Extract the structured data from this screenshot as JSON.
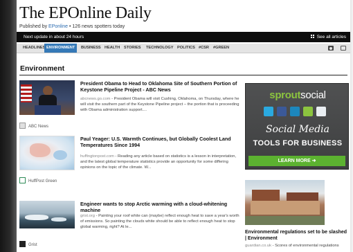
{
  "site": {
    "title": "The EPOnline Daily",
    "byline_prefix": "Published by",
    "byline_link": "EPonline",
    "byline_suffix": " • 126 news spotters today"
  },
  "topbar": {
    "next_update": "Next update in about 24 hours",
    "see_all": "See all articles"
  },
  "nav": {
    "items": [
      "HEADLINES",
      "ENVIRONMENT",
      "BUSINESS",
      "HEALTH",
      "STORIES",
      "TECHNOLOGY",
      "POLITICS",
      "#CSR",
      "#GREEN"
    ],
    "active": "ENVIRONMENT",
    "icons": [
      "camera-icon",
      "image-icon"
    ]
  },
  "section": {
    "title": "Environment"
  },
  "articles": [
    {
      "headline": "President Obama to Head to Oklahoma Site of Southern Portion of Keystone Pipeline Project - ABC News",
      "summary_source": "abcnews.go.com",
      "summary": " - President Obama will visit Cushing, Oklahoma, on Thursday, where he will visit the southern part of the Keystone Pipeline project – the portion that is proceeding with Obama administration support....",
      "source": "ABC News"
    },
    {
      "headline": "Paul Yeager: U.S. Warmth Continues, but Globally Coolest Land Temperatures Since 1994",
      "summary_source": "huffingtonpost.com",
      "summary": " - Reading any article based on statistics is a lesson in interpretation, and the latest global temperature statistics provide an opportunity for some differing opinions on the topic of the climate. W...",
      "source": "HuffPost Green"
    },
    {
      "headline": "Engineer wants to stop Arctic warming with a cloud-whitening machine",
      "summary_source": "grist.org",
      "summary": " - Painting your roof white can (maybe) reflect enough heat to save a year's worth of emissions. So painting the clouds white should be able to reflect enough heat to stop global warming, right? At le...",
      "source": "Grist"
    }
  ],
  "ad": {
    "brand_a": "sprout",
    "brand_b": "social",
    "line1": "Social Media",
    "line2": "TOOLS FOR BUSINESS",
    "cta": "LEARN MORE ➜",
    "colors": {
      "background": "#4a4b4c",
      "brand_green": "#8cc43f",
      "cta_green": "#5cb230"
    },
    "social_icons": [
      "twitter-icon",
      "facebook-icon",
      "linkedin-icon",
      "check-icon",
      "analytics-icon"
    ]
  },
  "side_story": {
    "headline": "Environmental regulations set to be slashed | Environment",
    "summary_source": "guardian.co.uk",
    "summary": " - Scores of environmental regulations"
  },
  "colors": {
    "nav_active": "#3579b7",
    "link": "#2a6bb0",
    "topbar": "#0d0d0d"
  }
}
